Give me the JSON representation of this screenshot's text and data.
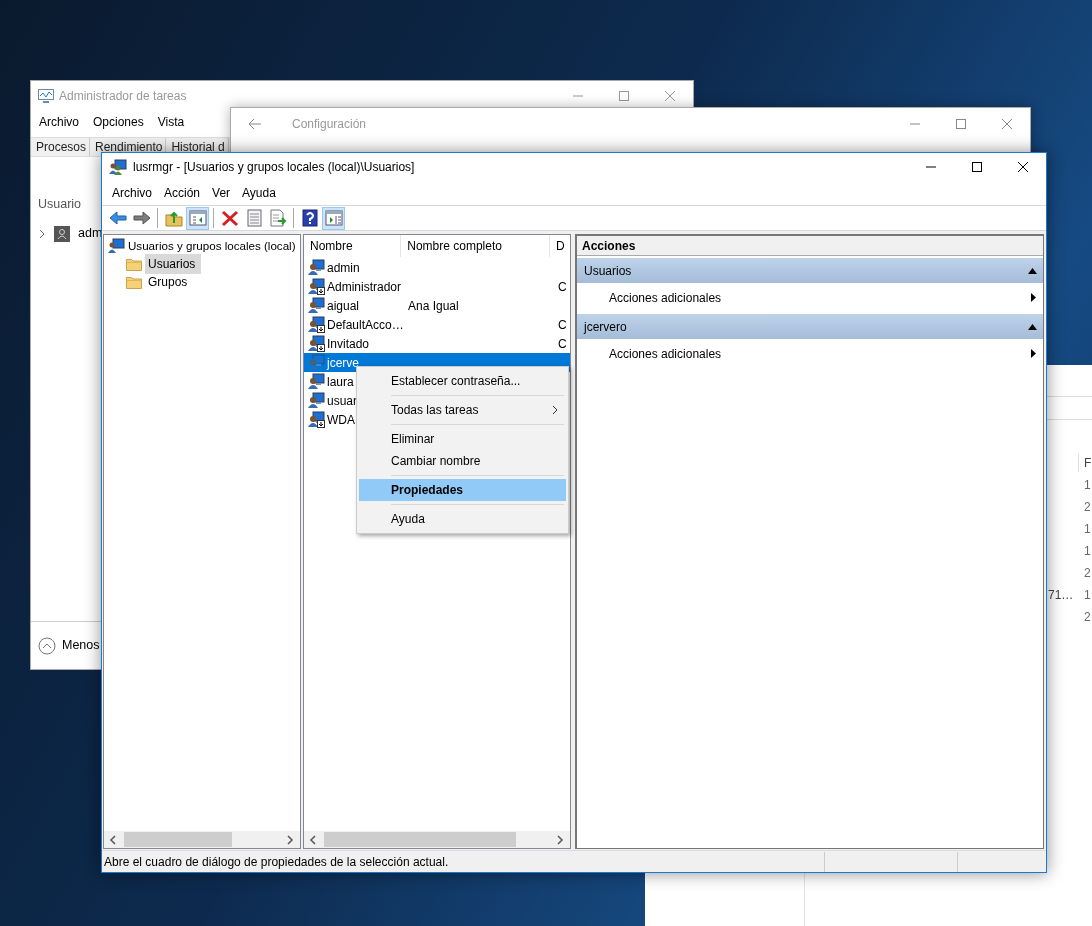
{
  "task_manager": {
    "title": "Administrador de tareas",
    "menu": [
      "Archivo",
      "Opciones",
      "Vista"
    ],
    "tabs": [
      {
        "label": "Procesos",
        "selected": false
      },
      {
        "label": "Rendimiento",
        "selected": false
      },
      {
        "label": "Historial d",
        "selected": false
      }
    ],
    "column": "Usuario",
    "rows": [
      {
        "name": "adm",
        "expanded": false
      }
    ],
    "footer": "Menos"
  },
  "settings_window": {
    "title": "Configuración"
  },
  "background_window": {
    "column_header": "F",
    "rows": [
      {
        "value": "1"
      },
      {
        "value": "2"
      },
      {
        "value": "1"
      },
      {
        "value": "1"
      },
      {
        "value": "2"
      },
      {
        "prefix": "71…",
        "value": "1"
      },
      {
        "value": "2"
      }
    ]
  },
  "main_window": {
    "title": "lusrmgr - [Usuarios y grupos locales (local)\\Usuarios]",
    "menu": [
      "Archivo",
      "Acción",
      "Ver",
      "Ayuda"
    ],
    "toolbar": [
      {
        "kind": "back",
        "pressed": false
      },
      {
        "kind": "forward",
        "pressed": false
      },
      {
        "kind": "separator"
      },
      {
        "kind": "up",
        "pressed": false
      },
      {
        "kind": "tree",
        "pressed": true
      },
      {
        "kind": "separator"
      },
      {
        "kind": "delete",
        "pressed": false
      },
      {
        "kind": "properties",
        "pressed": false
      },
      {
        "kind": "export",
        "pressed": false
      },
      {
        "kind": "separator"
      },
      {
        "kind": "help",
        "pressed": false
      },
      {
        "kind": "actions",
        "pressed": true
      }
    ],
    "tree": {
      "label": "Usuarios y grupos locales (local)",
      "children": [
        {
          "label": "Usuarios",
          "selected": true
        },
        {
          "label": "Grupos",
          "selected": false
        }
      ]
    },
    "columns": [
      "Nombre",
      "Nombre completo",
      "D"
    ],
    "rows": [
      {
        "name": "admin",
        "disabled": false,
        "selected": false
      },
      {
        "name": "Administrador",
        "description": "C",
        "disabled": true,
        "selected": false
      },
      {
        "name": "aigual",
        "full_name": "Ana Igual",
        "disabled": false,
        "selected": false
      },
      {
        "name": "DefaultAcco…",
        "description": "C",
        "disabled": true,
        "selected": false
      },
      {
        "name": "Invitado",
        "description": "C",
        "disabled": true,
        "selected": false
      },
      {
        "name": "jcerve",
        "disabled": false,
        "selected": true
      },
      {
        "name": "laura",
        "disabled": false,
        "selected": false
      },
      {
        "name": "usuar",
        "disabled": false,
        "selected": false
      },
      {
        "name": "WDA",
        "disabled": true,
        "selected": false
      }
    ],
    "context_menu": [
      [
        {
          "label": "Establecer contraseña...",
          "submenu": false,
          "default": false,
          "selected": false
        }
      ],
      [
        {
          "label": "Todas las tareas",
          "submenu": true,
          "default": false,
          "selected": false
        }
      ],
      [
        {
          "label": "Eliminar",
          "submenu": false,
          "default": false,
          "selected": false
        },
        {
          "label": "Cambiar nombre",
          "submenu": false,
          "default": false,
          "selected": false
        }
      ],
      [
        {
          "label": "Propiedades",
          "submenu": false,
          "default": true,
          "selected": true
        }
      ],
      [
        {
          "label": "Ayuda",
          "submenu": false,
          "default": false,
          "selected": false
        }
      ]
    ],
    "actions": {
      "title": "Acciones",
      "sections": [
        {
          "title": "Usuarios",
          "expanded": true,
          "items": [
            "Acciones adicionales"
          ]
        },
        {
          "title": "jcervero",
          "expanded": true,
          "items": [
            "Acciones adicionales"
          ]
        }
      ]
    },
    "status_bar": "Abre el cuadro de diálogo de propiedades de la selección actual."
  }
}
